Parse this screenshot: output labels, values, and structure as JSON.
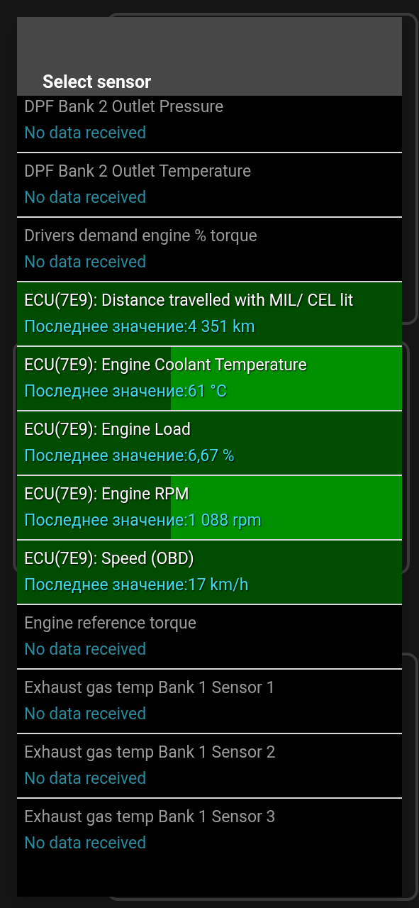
{
  "dialog": {
    "title": "Select sensor"
  },
  "sensors": [
    {
      "name": "DPF Bank 2 Outlet Pressure",
      "status": "No data received",
      "active": false
    },
    {
      "name": "DPF Bank 2 Outlet Temperature",
      "status": "No data received",
      "active": false
    },
    {
      "name": "Drivers demand engine % torque",
      "status": "No data received",
      "active": false
    },
    {
      "name": "ECU(7E9): Distance travelled with MIL/ CEL lit",
      "status": "Последнее значение:4 351 km",
      "active": true
    },
    {
      "name": "ECU(7E9): Engine Coolant Temperature",
      "status": "Последнее значение:61 °C",
      "active": true
    },
    {
      "name": "ECU(7E9): Engine Load",
      "status": "Последнее значение:6,67 %",
      "active": true
    },
    {
      "name": "ECU(7E9): Engine RPM",
      "status": "Последнее значение:1 088 rpm",
      "active": true
    },
    {
      "name": "ECU(7E9): Speed (OBD)",
      "status": "Последнее значение:17 km/h",
      "active": true
    },
    {
      "name": "Engine reference torque",
      "status": "No data received",
      "active": false
    },
    {
      "name": "Exhaust gas temp Bank 1 Sensor 1",
      "status": "No data received",
      "active": false
    },
    {
      "name": "Exhaust gas temp Bank 1 Sensor 2",
      "status": "No data received",
      "active": false
    },
    {
      "name": "Exhaust gas temp Bank 1 Sensor 3",
      "status": "No data received",
      "active": false
    }
  ]
}
